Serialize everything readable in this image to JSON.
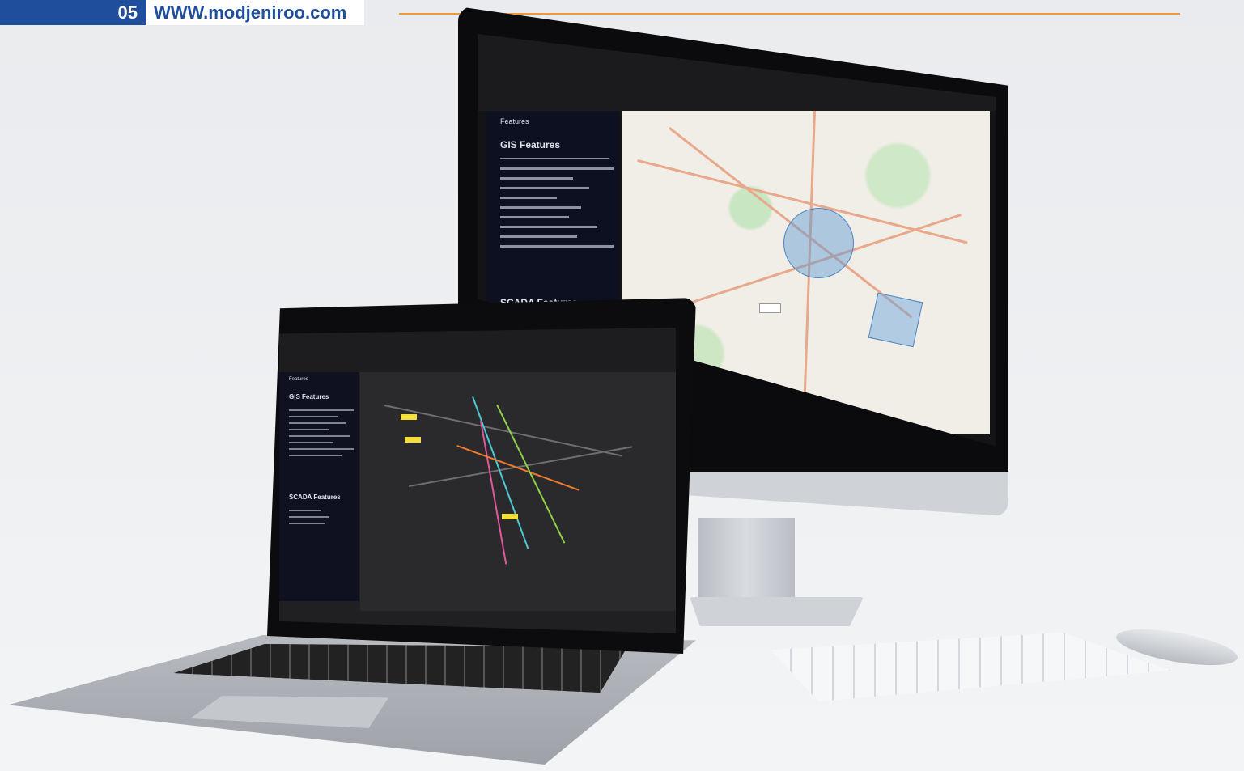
{
  "header": {
    "page_number": "05",
    "site_url": "WWW.modjeniroo.com"
  },
  "monitor_app": {
    "panel_tab": "Features",
    "gis_heading": "GIS Features",
    "scada_heading": "SCADA Features"
  },
  "laptop_app": {
    "panel_tab": "Features",
    "gis_heading": "GIS Features",
    "scada_heading": "SCADA Features"
  }
}
